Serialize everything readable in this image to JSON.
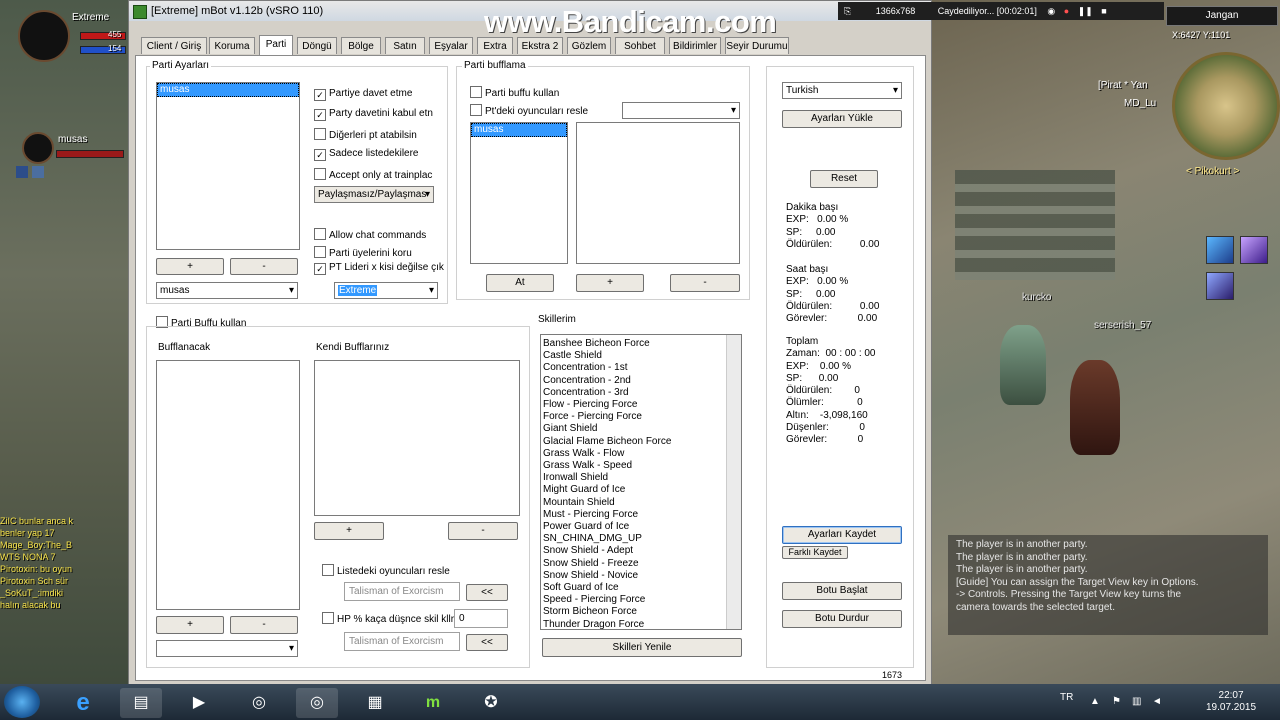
{
  "overlay": {
    "watermark": "www.Bandicam.com",
    "recorder_res": "1366x768",
    "recorder_status": "Caydediliyor... [00:02:01]"
  },
  "game": {
    "player_name": "Extreme",
    "hp": "455",
    "mp": "154",
    "party_member": "musas",
    "region": "Jangan",
    "coords": "X:6427   Y:1101",
    "minimap_label": "< Pikokurt >",
    "npc_1": "[Pirat * Yan",
    "npc_2": "MD_Lu",
    "char_1": "kurcko",
    "char_2": "serserish_57",
    "left_chat": [
      "ZiIC bunlar anca k",
      "benler  yap 17",
      "Mage_Boy:The_B",
      "WTS NONA 7",
      "Pirotoxin: bu oyun",
      "Pirotoxin Sch sür",
      "_SoKuT_:imdiki",
      "halın alacak bu"
    ],
    "right_chat": [
      "The player is in another party.",
      "The player is in another party.",
      "The player is in another party.",
      "[Guide] You can assign the Target View key in Options.",
      "     -> Controls.  Pressing the Target View key turns the",
      "     camera towards the selected target."
    ]
  },
  "window": {
    "title": "[Extreme] mBot v1.12b (vSRO 110)",
    "tabs": [
      "Client / Giriş",
      "Koruma",
      "Parti",
      "Döngü",
      "Bölge",
      "Satın",
      "Eşyalar",
      "Extra",
      "Ekstra 2",
      "Gözlem",
      "Sohbet",
      "Bildirimler",
      "Seyir Durumu"
    ],
    "active_tab": "Parti",
    "parti_ayarlari": {
      "label": "Parti Ayarları",
      "list": [
        "musas"
      ],
      "add_btn": "+",
      "remove_btn": "-",
      "combo_value": "musas",
      "checks": [
        {
          "label": "Partiye davet etme",
          "checked": true
        },
        {
          "label": "Party davetini kabul etn",
          "checked": true
        },
        {
          "label": "Diğerleri pt atabilsin",
          "checked": false
        },
        {
          "label": "Sadece listedekilere",
          "checked": true
        },
        {
          "label": "Accept only at trainplac",
          "checked": false
        }
      ],
      "mode_combo": "Paylaşmasız/Paylaşmas",
      "checks2": [
        {
          "label": "Allow chat commands",
          "checked": false
        },
        {
          "label": "Parti üyelerini koru",
          "checked": false
        },
        {
          "label": "PT Lideri x kisi değilse çık",
          "checked": true
        }
      ],
      "leader_combo": "Extreme"
    },
    "parti_bufflama": {
      "label": "Parti bufflama",
      "check1": "Parti buffu kullan",
      "check2": "Pt'deki oyuncuları resle",
      "list": [
        "musas"
      ],
      "at_btn": "At",
      "add_btn": "+",
      "remove_btn": "-"
    },
    "buff_section": {
      "check": "Parti Buffu kullan",
      "bufflanacak": "Bufflanacak",
      "kendi": "Kendi Bufflarınız",
      "add_btn": "+",
      "remove_btn": "-",
      "res_check": "Listedeki oyuncuları resle",
      "res_skill": "Talisman of Exorcism",
      "hp_check": "HP % kaça düşnce skil kllr",
      "hp_value": "0",
      "hp_skill": "Talisman of Exorcism",
      "arrow_btn": "<<"
    },
    "skills": {
      "label": "Skillerim",
      "items": [
        "Banshee Bicheon Force",
        "Castle Shield",
        "Concentration - 1st",
        "Concentration - 2nd",
        "Concentration - 3rd",
        "Flow - Piercing Force",
        "Force - Piercing Force",
        "Giant Shield",
        "Glacial Flame Bicheon Force",
        "Grass Walk - Flow",
        "Grass Walk - Speed",
        "Ironwall Shield",
        "Might Guard of Ice",
        "Mountain Shield",
        "Must - Piercing Force",
        "Power Guard of Ice",
        "SN_CHINA_DMG_UP",
        "Snow Shield - Adept",
        "Snow Shield - Freeze",
        "Snow Shield - Novice",
        "Soft Guard of Ice",
        "Speed - Piercing Force",
        "Storm Bicheon Force",
        "Thunder Dragon Force"
      ],
      "refresh_btn": "Skilleri Yenile"
    },
    "right_panel": {
      "lang": "Turkish",
      "load_btn": "Ayarları Yükle",
      "reset_btn": "Reset",
      "per_min": {
        "title": "Dakika başı",
        "exp": "EXP:   0.00 %",
        "sp": "SP:     0.00",
        "kills": "Öldürülen:          0.00"
      },
      "per_hour": {
        "title": "Saat başı",
        "exp": "EXP:   0.00 %",
        "sp": "SP:     0.00",
        "kills": "Öldürülen:          0.00",
        "quests": "Görevler:           0.00"
      },
      "total": {
        "title": "Toplam",
        "time": "Zaman:  00 : 00 : 00",
        "exp": "EXP:    0.00 %",
        "sp": "SP:      0.00",
        "kills": "Öldürülen:        0",
        "deaths": "Ölümler:            0",
        "gold": "Altın:    -3,098,160",
        "drops": "Düşenler:           0",
        "quests": "Görevler:           0"
      },
      "save_btn": "Ayarları Kaydet",
      "save_as_btn": "Farklı Kaydet",
      "start_btn": "Botu Başlat",
      "stop_btn": "Botu Durdur",
      "counter": "1673"
    }
  },
  "taskbar": {
    "lang": "TR",
    "time": "22:07",
    "date": "19.07.2015"
  },
  "colors": {
    "selection": "#3399ff",
    "window_bg": "#d4d0c8"
  }
}
